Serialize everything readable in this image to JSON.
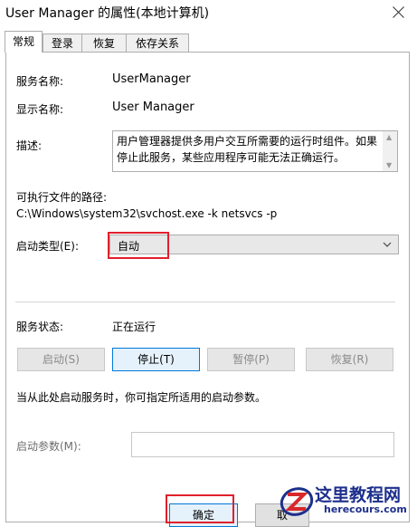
{
  "window": {
    "title": "User Manager 的属性(本地计算机)"
  },
  "tabs": [
    {
      "label": "常规",
      "active": true
    },
    {
      "label": "登录"
    },
    {
      "label": "恢复"
    },
    {
      "label": "依存关系"
    }
  ],
  "general": {
    "service_name_label": "服务名称:",
    "service_name": "UserManager",
    "display_name_label": "显示名称:",
    "display_name": "User Manager",
    "description_label": "描述:",
    "description": "用户管理器提供多用户交互所需要的运行时组件。如果停止此服务，某些应用程序可能无法正确运行。",
    "path_label": "可执行文件的路径:",
    "path": "C:\\Windows\\system32\\svchost.exe -k netsvcs -p",
    "startup_type_label": "启动类型(E):",
    "startup_type": "自动",
    "status_label": "服务状态:",
    "status": "正在运行",
    "buttons": {
      "start": "启动(S)",
      "stop": "停止(T)",
      "pause": "暂停(P)",
      "resume": "恢复(R)"
    },
    "hint": "当从此处启动服务时，你可指定所适用的启动参数。",
    "params_label": "启动参数(M):",
    "params_value": ""
  },
  "footer": {
    "ok": "确定",
    "other": "取"
  },
  "watermark": {
    "brand": "这里教程网",
    "url": "herecours.com"
  },
  "colors": {
    "highlight": "#e0202c",
    "focus_border": "#0078d7"
  }
}
